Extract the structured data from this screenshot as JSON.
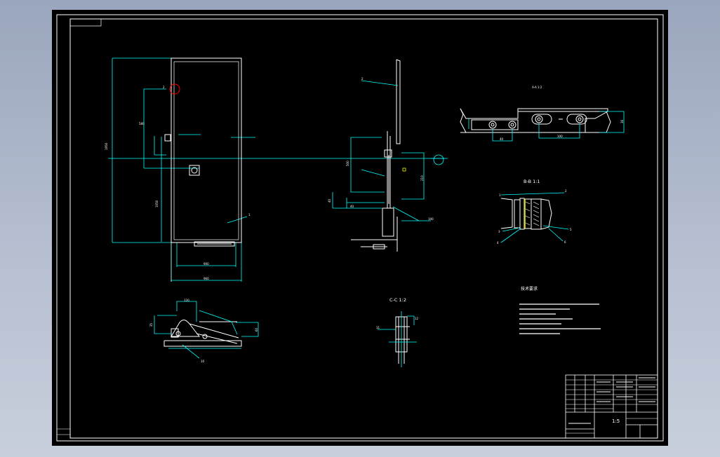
{
  "drawing": {
    "section_bb_label": "B-B  1:1",
    "section_cc_label": "C-C  1:2",
    "tech_requirements_heading": "技术要求"
  },
  "title_block": {
    "scale_label": "1:5"
  },
  "colors": {
    "background_outer": "#a7b1c6",
    "canvas": "#000000",
    "frame_lines": "#ffffff",
    "dimension_lines": "#00ffff",
    "hatch_magenta": "#ff00ff",
    "highlight_red": "#ff0000",
    "accent_yellow": "#ffff00"
  }
}
